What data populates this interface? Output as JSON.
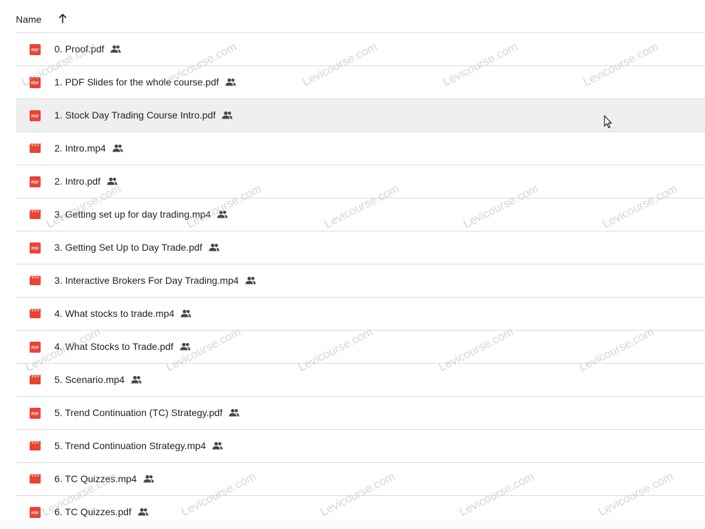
{
  "header": {
    "name_label": "Name",
    "sort_icon": "arrow-up-icon"
  },
  "files": [
    {
      "name": "0. Proof.pdf",
      "type": "pdf",
      "shared": true
    },
    {
      "name": "1. PDF Slides for the whole course.pdf",
      "type": "pdf",
      "shared": true
    },
    {
      "name": "1. Stock Day Trading Course Intro.pdf",
      "type": "pdf",
      "shared": true,
      "hovered": true
    },
    {
      "name": "2. Intro.mp4",
      "type": "video",
      "shared": true
    },
    {
      "name": "2. Intro.pdf",
      "type": "pdf",
      "shared": true
    },
    {
      "name": "3. Getting set up for day trading.mp4",
      "type": "video",
      "shared": true
    },
    {
      "name": "3. Getting Set Up to Day Trade.pdf",
      "type": "pdf",
      "shared": true
    },
    {
      "name": "3. Interactive Brokers For Day Trading.mp4",
      "type": "video",
      "shared": true
    },
    {
      "name": "4. What stocks to trade.mp4",
      "type": "video",
      "shared": true
    },
    {
      "name": "4. What Stocks to Trade.pdf",
      "type": "pdf",
      "shared": true
    },
    {
      "name": "5. Scenario.mp4",
      "type": "video",
      "shared": true
    },
    {
      "name": "5. Trend Continuation (TC) Strategy.pdf",
      "type": "pdf",
      "shared": true
    },
    {
      "name": "5. Trend Continuation Strategy.mp4",
      "type": "video",
      "shared": true
    },
    {
      "name": "6. TC Quizzes.mp4",
      "type": "video",
      "shared": true
    },
    {
      "name": "6. TC Quizzes.pdf",
      "type": "pdf",
      "shared": true
    }
  ],
  "watermark_text": "Levicourse.com",
  "colors": {
    "pdf_red": "#ea4335",
    "video_red": "#ea4335",
    "divider": "#dadce0",
    "hover_bg": "#efefef",
    "text": "#1f1f1f",
    "shared_icon": "#444746"
  }
}
